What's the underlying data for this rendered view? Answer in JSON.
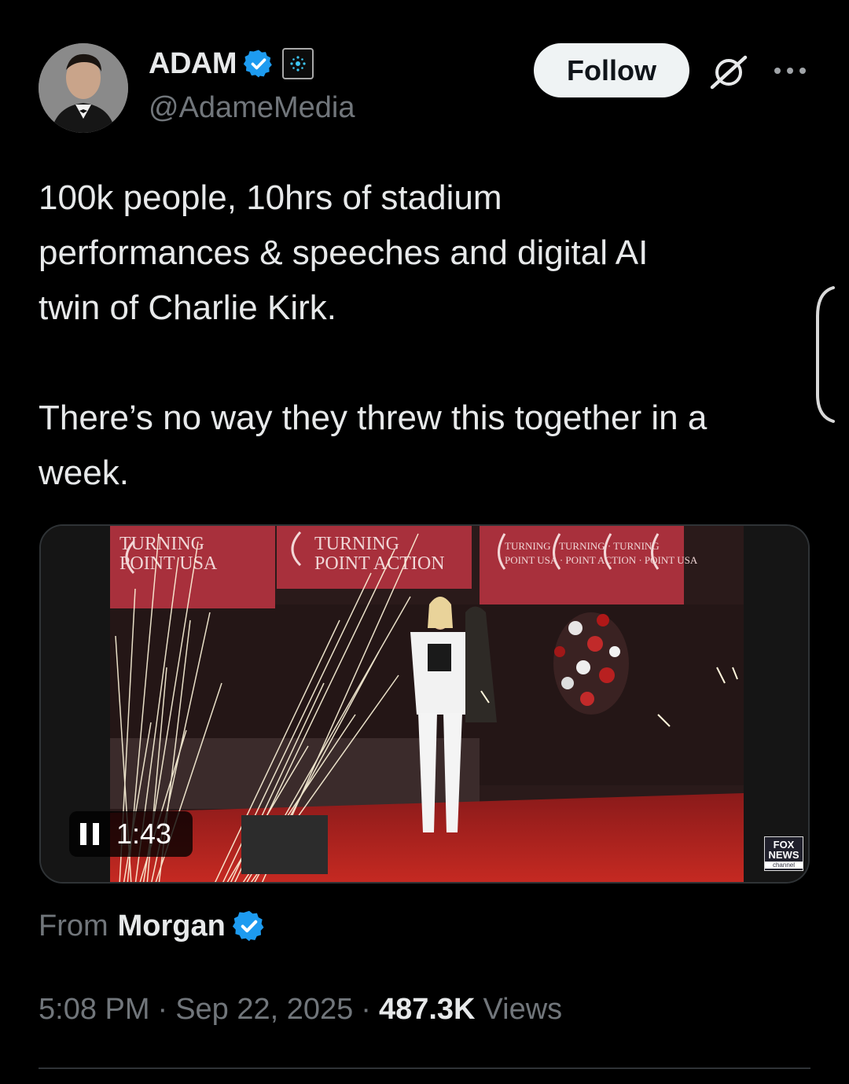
{
  "header": {
    "display_name": "ADAM",
    "handle": "@AdameMedia",
    "verified_icon": "verified-badge-icon",
    "affiliate_icon": "affiliate-badge-icon",
    "follow_label": "Follow",
    "grok_icon": "grok-icon",
    "more_icon": "more-icon"
  },
  "tweet": {
    "text": "100k people, 10hrs of stadium\nperformances & speeches and digital AI\ntwin of Charlie Kirk.\n\nThere’s no way they threw this together in a\nweek."
  },
  "video": {
    "duration": "1:43",
    "pause_icon": "pause-icon",
    "banner_texts": [
      "TURNING POINT USA",
      "TURNING POINT ACTION",
      "TURNING POINT USA"
    ],
    "watermark": {
      "line1": "FOX",
      "line2": "NEWS",
      "line3": "channel"
    }
  },
  "source": {
    "from_label": "From",
    "from_name": "Morgan"
  },
  "meta": {
    "time": "5:08 PM",
    "separator": "·",
    "date": "Sep 22, 2025",
    "views_count": "487.3K",
    "views_label": "Views"
  },
  "colors": {
    "background": "#000000",
    "text_primary": "#e7e9ea",
    "text_secondary": "#71767b",
    "verified_blue": "#1d9bf0",
    "follow_bg": "#eff3f4"
  }
}
